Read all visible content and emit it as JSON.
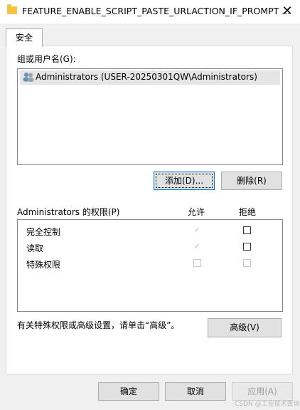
{
  "window": {
    "title": "FEATURE_ENABLE_SCRIPT_PASTE_URLACTION_IF_PROMPT ...",
    "close_glyph": "✕"
  },
  "tabs": [
    {
      "label": "安全"
    }
  ],
  "groups": {
    "label": "组或用户名(G):",
    "items": [
      {
        "label": "Administrators (USER-20250301QW\\Administrators)",
        "icon": "users-icon"
      }
    ]
  },
  "buttons": {
    "add": "添加(D)...",
    "remove": "删除(R)",
    "advanced": "高级(V)",
    "ok": "确定",
    "cancel": "取消",
    "apply": "应用(A)"
  },
  "permissions": {
    "title": "Administrators 的权限(P)",
    "allow_header": "允许",
    "deny_header": "拒绝",
    "rows": [
      {
        "label": "完全控制",
        "allow": "checked-disabled",
        "deny": "unchecked"
      },
      {
        "label": "读取",
        "allow": "checked-disabled",
        "deny": "unchecked"
      },
      {
        "label": "特殊权限",
        "allow": "disabled",
        "deny": "disabled"
      }
    ]
  },
  "advanced_note": "有关特殊权限或高级设置，请单击“高级”。",
  "watermark": "CSDN @工业技术查询",
  "colors": {
    "focus": "#0078d7",
    "folder": "#f5c242"
  }
}
